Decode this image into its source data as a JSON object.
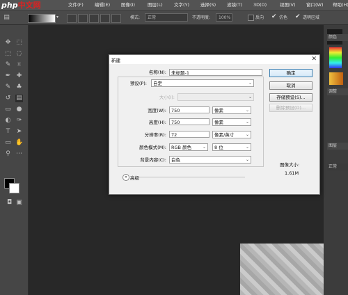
{
  "watermark": {
    "part1": "php",
    "part2": "中文网"
  },
  "menu": [
    "文件(F)",
    "编辑(E)",
    "图像(I)",
    "图层(L)",
    "文字(Y)",
    "选择(S)",
    "滤镜(T)",
    "3D(D)",
    "视图(V)",
    "窗口(W)",
    "帮助(H)"
  ],
  "options": {
    "mode_label": "模式:",
    "mode_value": "正常",
    "opacity_label": "不透明度:",
    "opacity_value": "100%",
    "reverse": "反向",
    "dither": "仿色",
    "transparency": "透明区域"
  },
  "right_panels": [
    "颜色",
    "调整",
    "图层",
    "正常"
  ],
  "dialog": {
    "title": "新建",
    "name_label": "名称(N):",
    "name_value": "未标题-1",
    "preset_label": "预设(P):",
    "preset_value": "自定",
    "size_label": "大小(I):",
    "width_label": "宽度(W):",
    "width_value": "750",
    "width_unit": "像素",
    "height_label": "高度(H):",
    "height_value": "750",
    "height_unit": "像素",
    "resolution_label": "分辨率(R):",
    "resolution_value": "72",
    "resolution_unit": "像素/英寸",
    "color_mode_label": "颜色模式(M):",
    "color_mode_value": "RGB 颜色",
    "bit_depth_value": "8 位",
    "bg_label": "背景内容(C):",
    "bg_value": "白色",
    "advanced_label": "高级",
    "ok_label": "确定",
    "cancel_label": "取消",
    "save_preset_label": "存储预设(S)...",
    "delete_preset_label": "删除预设(D)...",
    "image_size_label": "图像大小:",
    "image_size_value": "1.61M"
  }
}
